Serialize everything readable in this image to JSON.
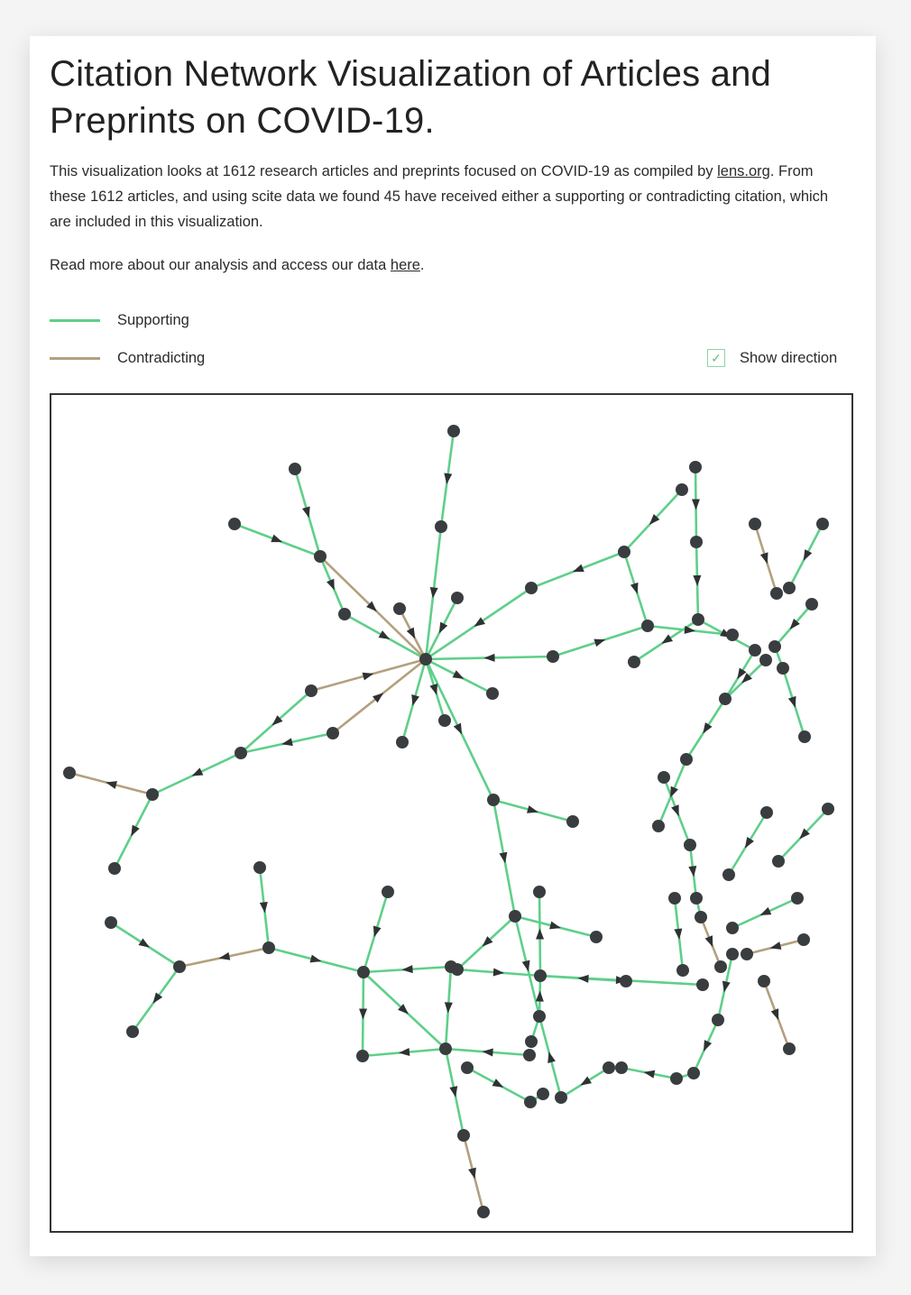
{
  "header": {
    "title": "Citation Network Visualization of Articles and Preprints on COVID-19."
  },
  "description": {
    "part1": "This visualization looks at 1612 research articles and preprints focused on COVID-19 as compiled by ",
    "link_lens": "lens.org",
    "part2": ". From these 1612 articles, and using scite data we found 45 have received either a supporting or contradicting citation, which are included in this visualization."
  },
  "read_more": {
    "text": "Read more about our analysis and access our data ",
    "link": "here",
    "suffix": "."
  },
  "legend": {
    "supporting_label": "Supporting",
    "contradicting_label": "Contradicting"
  },
  "colors": {
    "supporting": "#5fcf8a",
    "contradicting": "#b3a07e",
    "node": "#3a3d3f"
  },
  "controls": {
    "show_direction_label": "Show direction",
    "show_direction_checked": true
  }
}
